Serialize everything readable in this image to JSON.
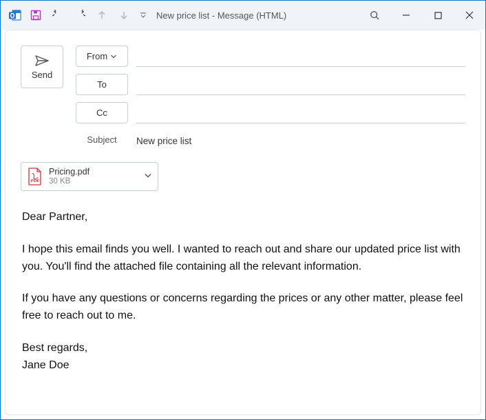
{
  "window": {
    "title": "New price list  -  Message (HTML)"
  },
  "toolbar": {
    "send_label": "Send",
    "from_label": "From",
    "to_label": "To",
    "cc_label": "Cc",
    "subject_label": "Subject"
  },
  "compose": {
    "from_value": "",
    "to_value": "",
    "cc_value": "",
    "subject_value": "New price list"
  },
  "attachment": {
    "name": "Pricing.pdf",
    "size": "30 KB",
    "icon": "pdf-icon"
  },
  "body": {
    "greeting": "Dear Partner,",
    "p1": "I hope this email finds you well. I wanted to reach out and share our updated price list with you. You'll find the attached file containing all the relevant information.",
    "p2": "If you have any questions or concerns regarding the prices or any other matter, please feel free to reach out to me.",
    "signoff": "Best regards,",
    "sender": "Jane Doe"
  }
}
